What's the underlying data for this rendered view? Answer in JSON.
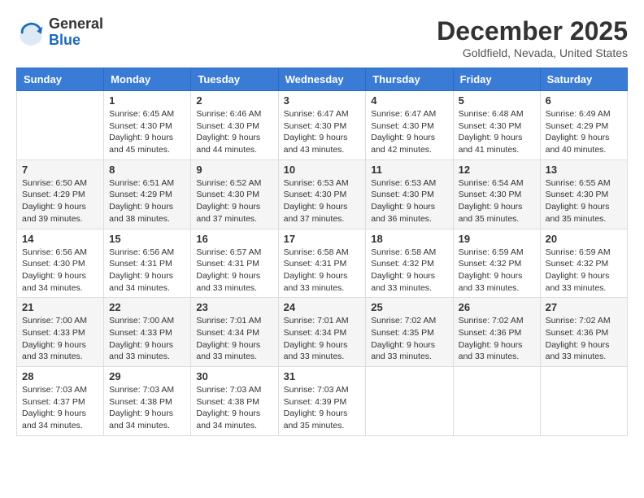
{
  "header": {
    "logo_general": "General",
    "logo_blue": "Blue",
    "month_title": "December 2025",
    "location": "Goldfield, Nevada, United States"
  },
  "days_of_week": [
    "Sunday",
    "Monday",
    "Tuesday",
    "Wednesday",
    "Thursday",
    "Friday",
    "Saturday"
  ],
  "weeks": [
    [
      {
        "day": "",
        "sunrise": "",
        "sunset": "",
        "daylight": ""
      },
      {
        "day": "1",
        "sunrise": "Sunrise: 6:45 AM",
        "sunset": "Sunset: 4:30 PM",
        "daylight": "Daylight: 9 hours and 45 minutes."
      },
      {
        "day": "2",
        "sunrise": "Sunrise: 6:46 AM",
        "sunset": "Sunset: 4:30 PM",
        "daylight": "Daylight: 9 hours and 44 minutes."
      },
      {
        "day": "3",
        "sunrise": "Sunrise: 6:47 AM",
        "sunset": "Sunset: 4:30 PM",
        "daylight": "Daylight: 9 hours and 43 minutes."
      },
      {
        "day": "4",
        "sunrise": "Sunrise: 6:47 AM",
        "sunset": "Sunset: 4:30 PM",
        "daylight": "Daylight: 9 hours and 42 minutes."
      },
      {
        "day": "5",
        "sunrise": "Sunrise: 6:48 AM",
        "sunset": "Sunset: 4:30 PM",
        "daylight": "Daylight: 9 hours and 41 minutes."
      },
      {
        "day": "6",
        "sunrise": "Sunrise: 6:49 AM",
        "sunset": "Sunset: 4:29 PM",
        "daylight": "Daylight: 9 hours and 40 minutes."
      }
    ],
    [
      {
        "day": "7",
        "sunrise": "Sunrise: 6:50 AM",
        "sunset": "Sunset: 4:29 PM",
        "daylight": "Daylight: 9 hours and 39 minutes."
      },
      {
        "day": "8",
        "sunrise": "Sunrise: 6:51 AM",
        "sunset": "Sunset: 4:29 PM",
        "daylight": "Daylight: 9 hours and 38 minutes."
      },
      {
        "day": "9",
        "sunrise": "Sunrise: 6:52 AM",
        "sunset": "Sunset: 4:30 PM",
        "daylight": "Daylight: 9 hours and 37 minutes."
      },
      {
        "day": "10",
        "sunrise": "Sunrise: 6:53 AM",
        "sunset": "Sunset: 4:30 PM",
        "daylight": "Daylight: 9 hours and 37 minutes."
      },
      {
        "day": "11",
        "sunrise": "Sunrise: 6:53 AM",
        "sunset": "Sunset: 4:30 PM",
        "daylight": "Daylight: 9 hours and 36 minutes."
      },
      {
        "day": "12",
        "sunrise": "Sunrise: 6:54 AM",
        "sunset": "Sunset: 4:30 PM",
        "daylight": "Daylight: 9 hours and 35 minutes."
      },
      {
        "day": "13",
        "sunrise": "Sunrise: 6:55 AM",
        "sunset": "Sunset: 4:30 PM",
        "daylight": "Daylight: 9 hours and 35 minutes."
      }
    ],
    [
      {
        "day": "14",
        "sunrise": "Sunrise: 6:56 AM",
        "sunset": "Sunset: 4:30 PM",
        "daylight": "Daylight: 9 hours and 34 minutes."
      },
      {
        "day": "15",
        "sunrise": "Sunrise: 6:56 AM",
        "sunset": "Sunset: 4:31 PM",
        "daylight": "Daylight: 9 hours and 34 minutes."
      },
      {
        "day": "16",
        "sunrise": "Sunrise: 6:57 AM",
        "sunset": "Sunset: 4:31 PM",
        "daylight": "Daylight: 9 hours and 33 minutes."
      },
      {
        "day": "17",
        "sunrise": "Sunrise: 6:58 AM",
        "sunset": "Sunset: 4:31 PM",
        "daylight": "Daylight: 9 hours and 33 minutes."
      },
      {
        "day": "18",
        "sunrise": "Sunrise: 6:58 AM",
        "sunset": "Sunset: 4:32 PM",
        "daylight": "Daylight: 9 hours and 33 minutes."
      },
      {
        "day": "19",
        "sunrise": "Sunrise: 6:59 AM",
        "sunset": "Sunset: 4:32 PM",
        "daylight": "Daylight: 9 hours and 33 minutes."
      },
      {
        "day": "20",
        "sunrise": "Sunrise: 6:59 AM",
        "sunset": "Sunset: 4:32 PM",
        "daylight": "Daylight: 9 hours and 33 minutes."
      }
    ],
    [
      {
        "day": "21",
        "sunrise": "Sunrise: 7:00 AM",
        "sunset": "Sunset: 4:33 PM",
        "daylight": "Daylight: 9 hours and 33 minutes."
      },
      {
        "day": "22",
        "sunrise": "Sunrise: 7:00 AM",
        "sunset": "Sunset: 4:33 PM",
        "daylight": "Daylight: 9 hours and 33 minutes."
      },
      {
        "day": "23",
        "sunrise": "Sunrise: 7:01 AM",
        "sunset": "Sunset: 4:34 PM",
        "daylight": "Daylight: 9 hours and 33 minutes."
      },
      {
        "day": "24",
        "sunrise": "Sunrise: 7:01 AM",
        "sunset": "Sunset: 4:34 PM",
        "daylight": "Daylight: 9 hours and 33 minutes."
      },
      {
        "day": "25",
        "sunrise": "Sunrise: 7:02 AM",
        "sunset": "Sunset: 4:35 PM",
        "daylight": "Daylight: 9 hours and 33 minutes."
      },
      {
        "day": "26",
        "sunrise": "Sunrise: 7:02 AM",
        "sunset": "Sunset: 4:36 PM",
        "daylight": "Daylight: 9 hours and 33 minutes."
      },
      {
        "day": "27",
        "sunrise": "Sunrise: 7:02 AM",
        "sunset": "Sunset: 4:36 PM",
        "daylight": "Daylight: 9 hours and 33 minutes."
      }
    ],
    [
      {
        "day": "28",
        "sunrise": "Sunrise: 7:03 AM",
        "sunset": "Sunset: 4:37 PM",
        "daylight": "Daylight: 9 hours and 34 minutes."
      },
      {
        "day": "29",
        "sunrise": "Sunrise: 7:03 AM",
        "sunset": "Sunset: 4:38 PM",
        "daylight": "Daylight: 9 hours and 34 minutes."
      },
      {
        "day": "30",
        "sunrise": "Sunrise: 7:03 AM",
        "sunset": "Sunset: 4:38 PM",
        "daylight": "Daylight: 9 hours and 34 minutes."
      },
      {
        "day": "31",
        "sunrise": "Sunrise: 7:03 AM",
        "sunset": "Sunset: 4:39 PM",
        "daylight": "Daylight: 9 hours and 35 minutes."
      },
      {
        "day": "",
        "sunrise": "",
        "sunset": "",
        "daylight": ""
      },
      {
        "day": "",
        "sunrise": "",
        "sunset": "",
        "daylight": ""
      },
      {
        "day": "",
        "sunrise": "",
        "sunset": "",
        "daylight": ""
      }
    ]
  ]
}
